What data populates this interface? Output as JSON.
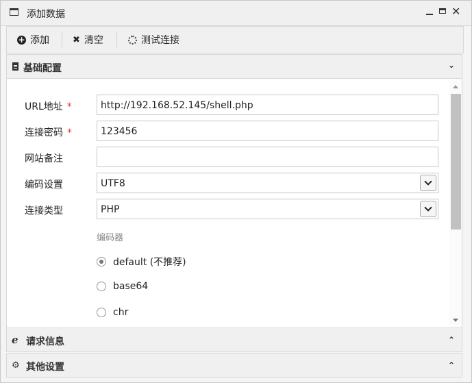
{
  "window": {
    "title": "添加数据"
  },
  "toolbar": {
    "add_label": "添加",
    "clear_label": "清空",
    "test_label": "测试连接"
  },
  "sections": {
    "basic": {
      "title": "基础配置"
    },
    "request": {
      "title": "请求信息"
    },
    "other": {
      "title": "其他设置"
    }
  },
  "form": {
    "url": {
      "label": "URL地址",
      "required": "*",
      "value": "http://192.168.52.145/shell.php"
    },
    "password": {
      "label": "连接密码",
      "required": "*",
      "value": "123456"
    },
    "note": {
      "label": "网站备注",
      "value": ""
    },
    "encoding": {
      "label": "编码设置",
      "value": "UTF8"
    },
    "type": {
      "label": "连接类型",
      "value": "PHP"
    },
    "encoder": {
      "label": "编码器",
      "options": [
        {
          "label": "default (不推荐)",
          "selected": true
        },
        {
          "label": "base64",
          "selected": false
        },
        {
          "label": "chr",
          "selected": false
        }
      ]
    }
  }
}
